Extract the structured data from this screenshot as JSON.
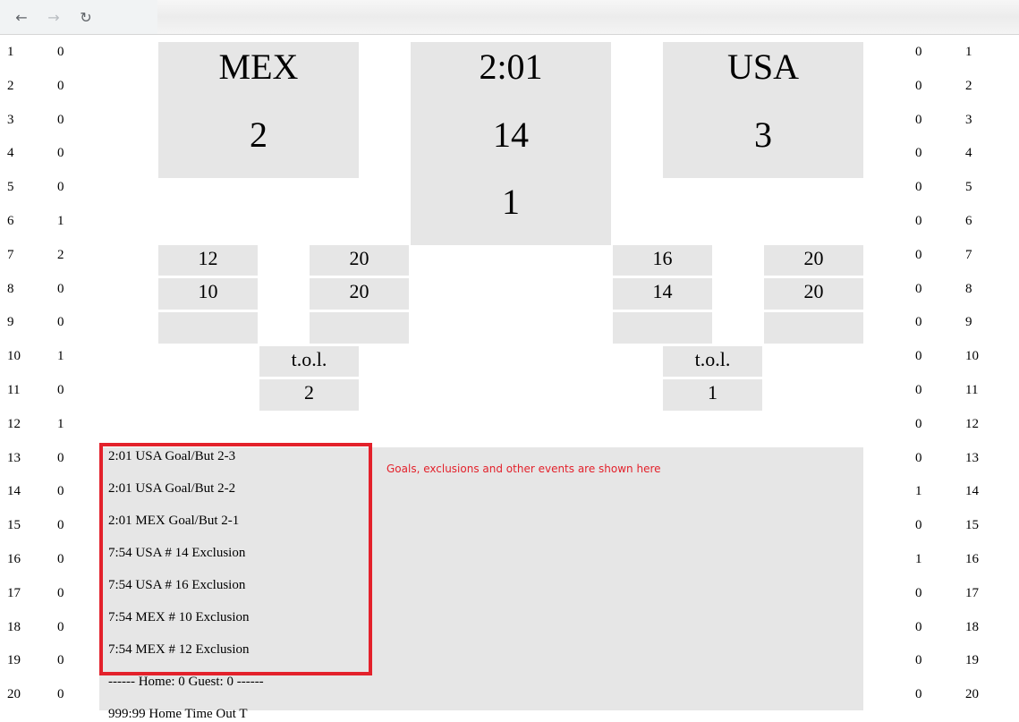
{
  "browser": {
    "back_icon": "←",
    "forward_icon": "→",
    "reload_icon": "↻"
  },
  "left_stats": {
    "numbers": [
      "1",
      "2",
      "3",
      "4",
      "5",
      "6",
      "7",
      "8",
      "9",
      "10",
      "11",
      "12",
      "13",
      "14",
      "15",
      "16",
      "17",
      "18",
      "19",
      "20"
    ],
    "values": [
      "0",
      "0",
      "0",
      "0",
      "0",
      "1",
      "2",
      "0",
      "0",
      "1",
      "0",
      "1",
      "0",
      "0",
      "0",
      "0",
      "0",
      "0",
      "0",
      "0"
    ]
  },
  "right_stats": {
    "values": [
      "0",
      "0",
      "0",
      "0",
      "0",
      "0",
      "0",
      "0",
      "0",
      "0",
      "0",
      "0",
      "0",
      "1",
      "0",
      "1",
      "0",
      "0",
      "0",
      "0"
    ],
    "numbers": [
      "1",
      "2",
      "3",
      "4",
      "5",
      "6",
      "7",
      "8",
      "9",
      "10",
      "11",
      "12",
      "13",
      "14",
      "15",
      "16",
      "17",
      "18",
      "19",
      "20"
    ]
  },
  "scoreboard": {
    "home_team": "MEX",
    "home_score": "2",
    "clock": "2:01",
    "shot_clock": "14",
    "period": "1",
    "guest_team": "USA",
    "guest_score": "3",
    "home_exclusions": [
      {
        "player": "12",
        "time": "20"
      },
      {
        "player": "10",
        "time": "20"
      },
      {
        "player": "",
        "time": ""
      }
    ],
    "guest_exclusions": [
      {
        "player": "16",
        "time": "20"
      },
      {
        "player": "14",
        "time": "20"
      },
      {
        "player": "",
        "time": ""
      }
    ],
    "home_tol_label": "t.o.l.",
    "home_tol_value": "2",
    "guest_tol_label": "t.o.l.",
    "guest_tol_value": "1"
  },
  "events": {
    "lines": [
      "2:01 USA Goal/But 2-3",
      "2:01 USA Goal/But 2-2",
      "2:01 MEX Goal/But 2-1",
      "7:54 USA # 14 Exclusion",
      "7:54 USA # 16 Exclusion",
      "7:54 MEX # 10 Exclusion",
      "7:54 MEX # 12 Exclusion",
      "------ Home: 0 Guest: 0 ------",
      "999:99 Home Time Out T"
    ],
    "annotation": "Goals, exclusions and other events are shown here",
    "highlight_color": "#e3212b"
  }
}
